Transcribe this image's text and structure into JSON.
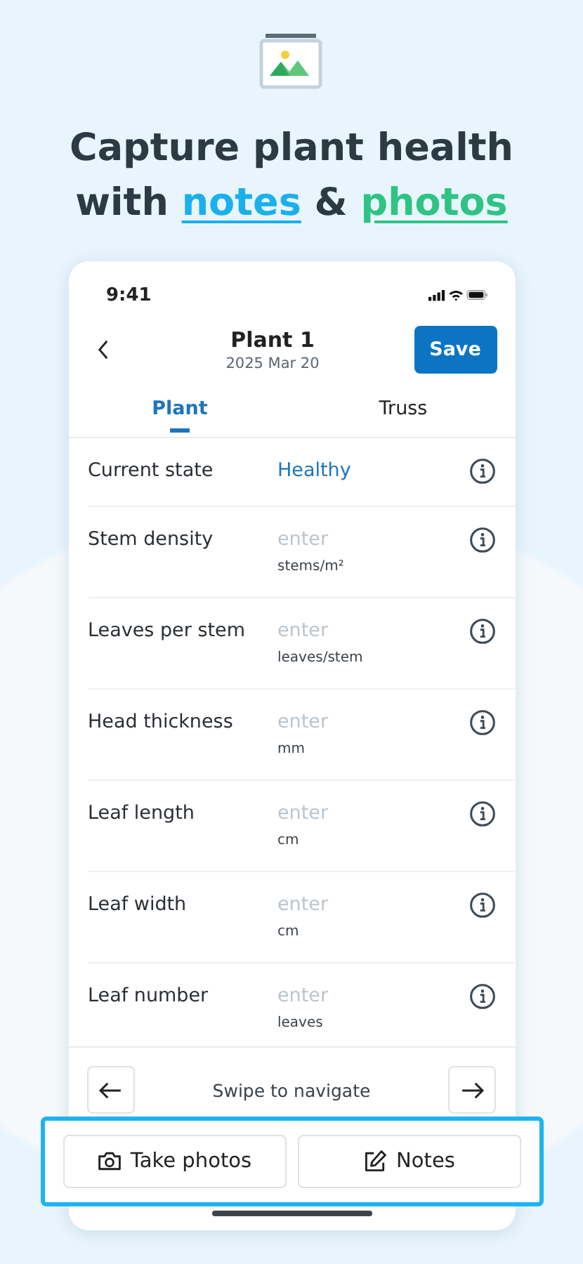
{
  "headline": {
    "line_1": "Capture plant health",
    "lead": "with",
    "highlight_1": "notes",
    "joiner": "&",
    "highlight_2": "photos"
  },
  "status_bar": {
    "time": "9:41"
  },
  "header": {
    "title": "Plant 1",
    "subtitle": "2025 Mar 20",
    "save_button": "Save"
  },
  "tabs": [
    {
      "label": "Plant",
      "selected": true
    },
    {
      "label": "Truss",
      "selected": false
    }
  ],
  "fields": [
    {
      "kind": "select",
      "label": "Current state",
      "value": "Healthy"
    },
    {
      "kind": "input",
      "label": "Stem density",
      "placeholder": "enter",
      "unit": "stems/m²"
    },
    {
      "kind": "input",
      "label": "Leaves per stem",
      "placeholder": "enter",
      "unit": "leaves/stem"
    },
    {
      "kind": "input",
      "label": "Head thickness",
      "placeholder": "enter",
      "unit": "mm"
    },
    {
      "kind": "input",
      "label": "Leaf length",
      "placeholder": "enter",
      "unit": "cm"
    },
    {
      "kind": "input",
      "label": "Leaf width",
      "placeholder": "enter",
      "unit": "cm"
    },
    {
      "kind": "input",
      "label": "Leaf number",
      "placeholder": "enter",
      "unit": "leaves"
    }
  ],
  "navigation": {
    "hint": "Swipe to navigate"
  },
  "actions": [
    "Take photos",
    "Notes"
  ]
}
